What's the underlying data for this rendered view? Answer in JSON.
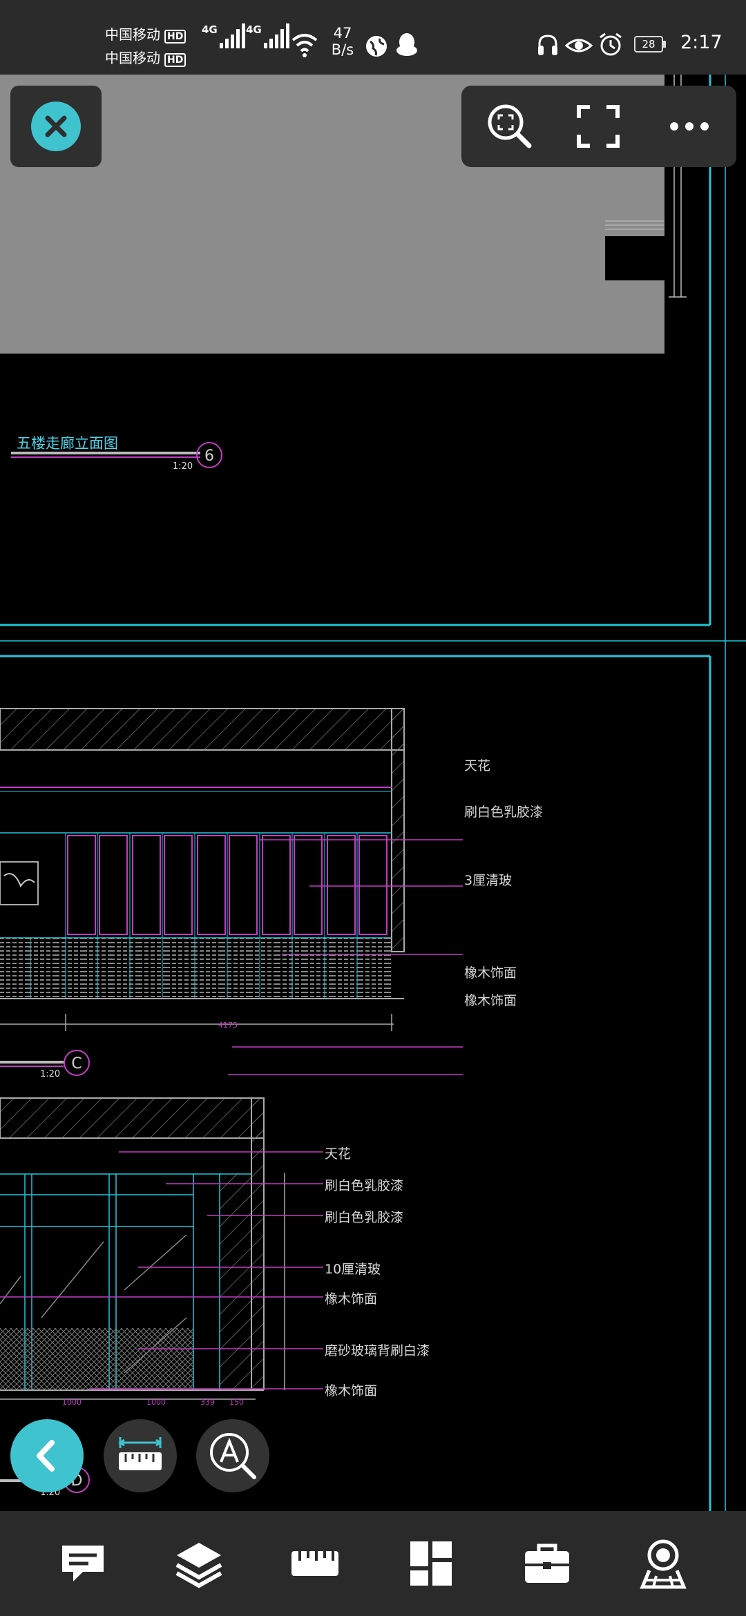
{
  "status_bar": {
    "carrier_1": "中国移动",
    "carrier_2": "中国移动",
    "hd_badge": "HD",
    "network_type": "4G",
    "net_speed_value": "47",
    "net_speed_unit": "B/s",
    "battery_level": "28",
    "time": "2:17"
  },
  "drawing": {
    "top_view": {
      "title": "五楼走廊立面图",
      "scale": "1:20",
      "badge": "6"
    },
    "middle_view": {
      "scale": "1:20",
      "badge": "C",
      "dimension_total": "4175",
      "annotations": [
        "天花",
        "刷白色乳胶漆",
        "3厘清玻",
        "橡木饰面",
        "橡木饰面"
      ]
    },
    "bottom_view": {
      "scale": "1:20",
      "badge": "D",
      "dimensions": [
        "1000",
        "1000",
        "339",
        "150"
      ],
      "annotations": [
        "天花",
        "刷白色乳胶漆",
        "刷白色乳胶漆",
        "10厘清玻",
        "橡木饰面",
        "磨砂玻璃背刷白漆",
        "橡木饰面"
      ]
    }
  },
  "colors": {
    "accent_teal": "#3fc3cf",
    "cad_cyan": "#1fc8dc",
    "cad_magenta": "#c43cc4",
    "panel_bg": "#2f2f2f"
  },
  "toolbar_icons": [
    "zoom-fit-icon",
    "fullscreen-icon",
    "more-icon"
  ],
  "fab_icons": [
    "back-icon",
    "measure-icon",
    "text-search-icon"
  ],
  "bottom_nav_icons": [
    "comment-icon",
    "layers-icon",
    "ruler-icon",
    "layout-icon",
    "toolbox-icon",
    "cloud-icon"
  ]
}
